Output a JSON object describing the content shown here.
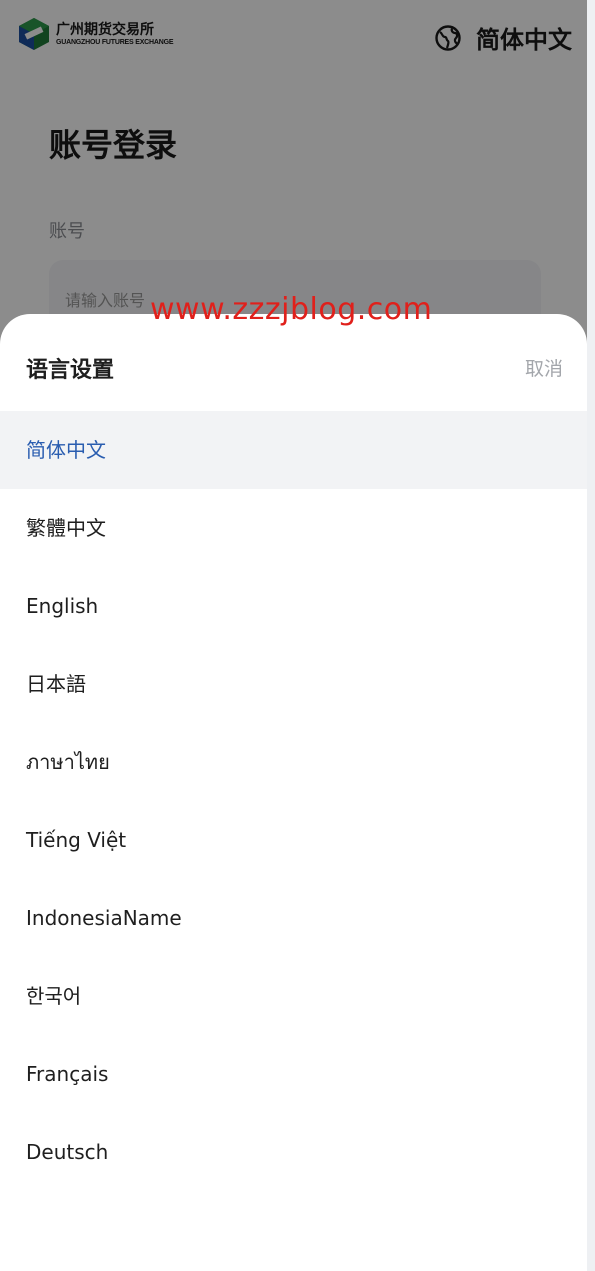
{
  "header": {
    "logo_cn": "广州期货交易所",
    "logo_en": "GUANGZHOU FUTURES EXCHANGE",
    "current_language": "简体中文",
    "icons": {
      "logo": "exchange-logo-icon",
      "globe": "globe-icon"
    }
  },
  "login": {
    "title": "账号登录",
    "account_label": "账号",
    "account_placeholder": "请输入账号"
  },
  "sheet": {
    "title": "语言设置",
    "cancel_label": "取消",
    "languages": [
      "简体中文",
      "繁體中文",
      "English",
      "日本語",
      "ภาษาไทย",
      "Tiếng Việt",
      "IndonesiaName",
      "한국어",
      "Français",
      "Deutsch"
    ],
    "selected_index": 0
  },
  "watermark": "www.zzzjblog.com",
  "colors": {
    "accent": "#2a5db0",
    "selected_bg": "#f2f3f5",
    "muted_text": "#a3a6ab",
    "watermark": "#e0201b"
  }
}
